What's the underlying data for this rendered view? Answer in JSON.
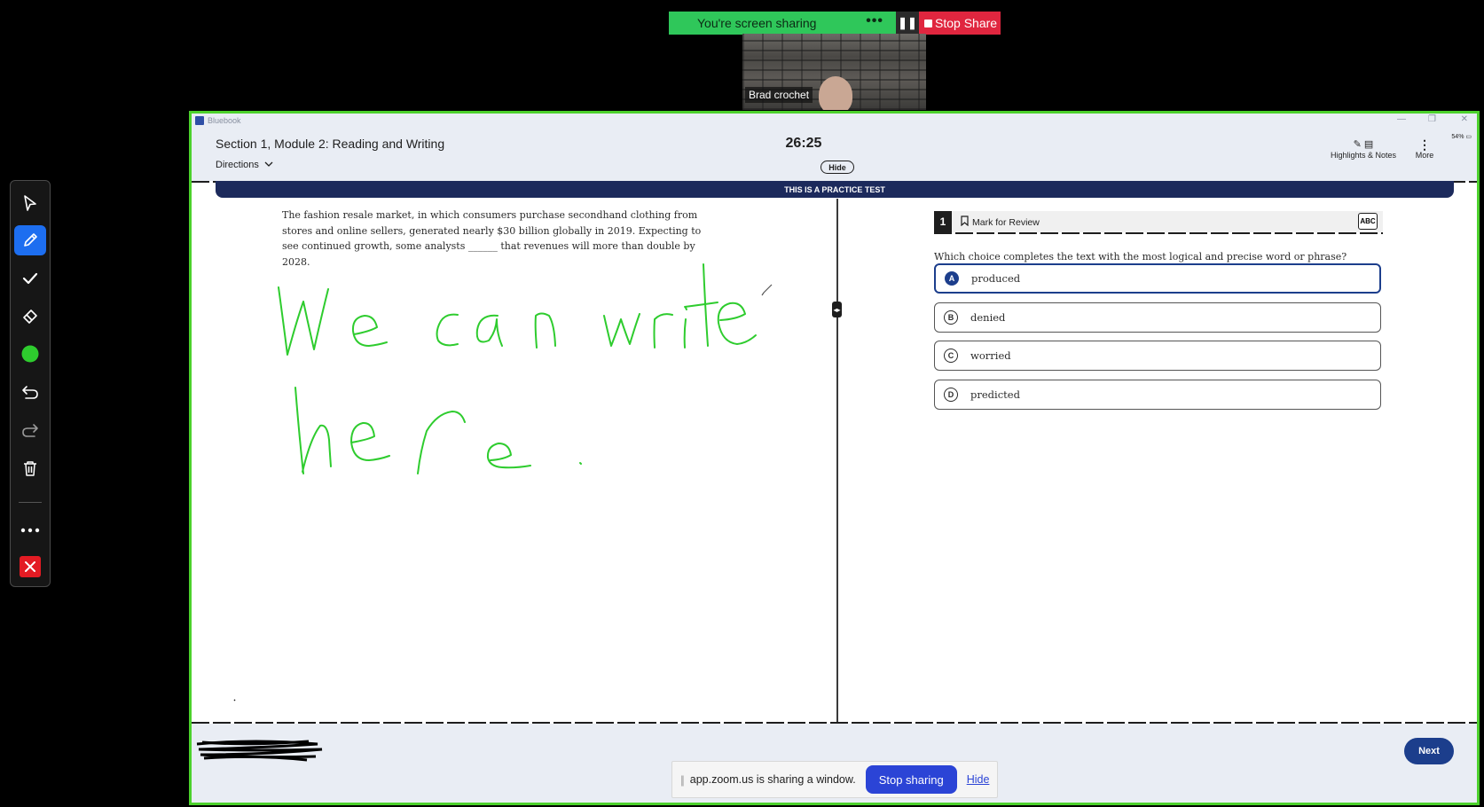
{
  "zoom": {
    "sharing_status": "You're screen sharing",
    "more_dots": "•••",
    "pause_glyph": "❚❚",
    "stop_share_label": "Stop Share",
    "participant_name": "Brad crochet",
    "notice_text": "app.zoom.us is sharing a window.",
    "notice_stop_label": "Stop sharing",
    "notice_hide_label": "Hide",
    "green": "#2fc75a",
    "red": "#e0263f"
  },
  "annotation_toolbar": {
    "tools": [
      "select-arrow-icon",
      "pen-icon",
      "stamp-check-icon",
      "eraser-icon",
      "color-dot-icon",
      "undo-icon",
      "redo-icon",
      "trash-icon",
      "more-icon",
      "close-icon"
    ],
    "selected_tool": "pen-icon",
    "pen_color": "#2ecc2e"
  },
  "bluebook": {
    "app_name": "Bluebook",
    "section_title": "Section 1, Module 2: Reading and Writing",
    "directions_label": "Directions",
    "timer": "26:25",
    "hide_label": "Hide",
    "battery": "54%",
    "highlights_label": "Highlights & Notes",
    "more_label": "More",
    "banner": "THIS IS A PRACTICE TEST",
    "passage": "The fashion resale market, in which consumers purchase secondhand clothing from stores and online sellers, generated nearly $30 billion globally in 2019. Expecting to see continued growth, some analysts ______ that revenues will more than double by 2028.",
    "handwriting_line1": "We can write",
    "handwriting_line2": "here.",
    "question_number": "1",
    "mark_for_review": "Mark for Review",
    "abc_label": "ABC",
    "question": "Which choice completes the text with the most logical and precise word or phrase?",
    "choices": [
      {
        "letter": "A",
        "text": "produced"
      },
      {
        "letter": "B",
        "text": "denied"
      },
      {
        "letter": "C",
        "text": "worried"
      },
      {
        "letter": "D",
        "text": "predicted"
      }
    ],
    "selected_choice": "A",
    "next_label": "Next",
    "accent": "#1c3e8c"
  }
}
